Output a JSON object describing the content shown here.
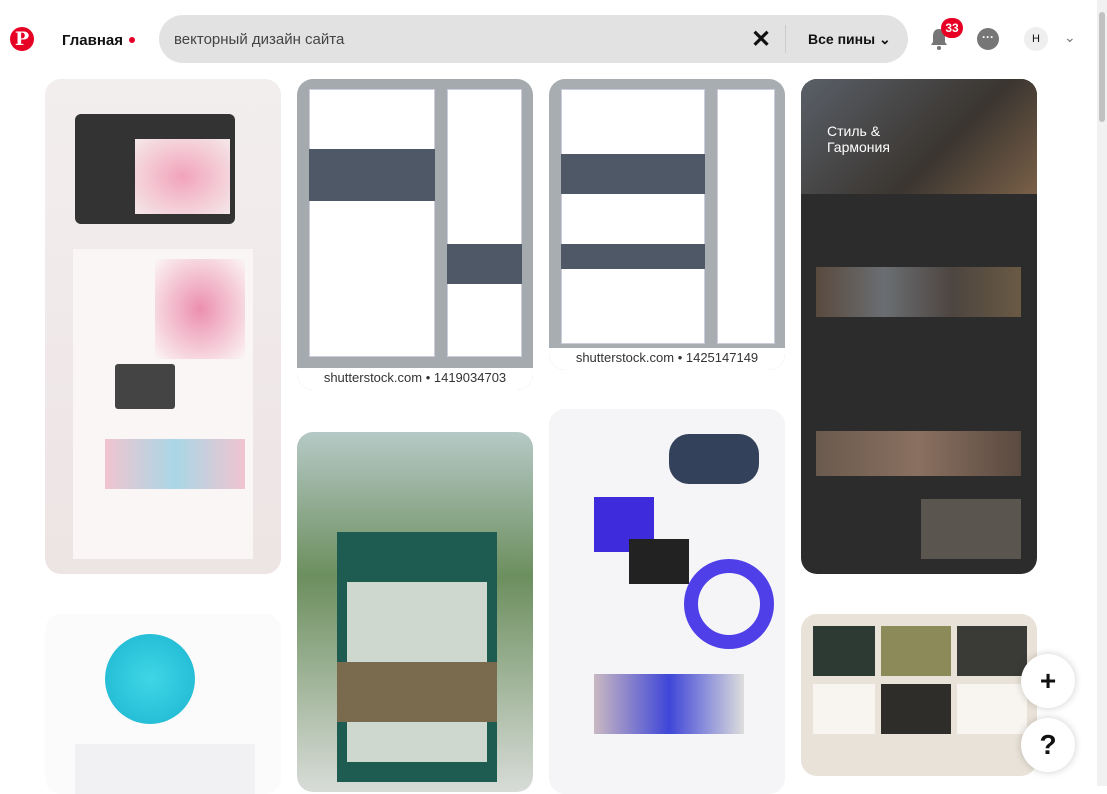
{
  "header": {
    "logo": "P",
    "home_label": "Главная",
    "search_value": "векторный дизайн сайта",
    "clear_icon": "x-icon",
    "filter_label": "Все пины",
    "notifications_count": "33",
    "avatar_initial": "Н"
  },
  "pins": [
    {
      "caption": ""
    },
    {
      "caption": "shutterstock.com • 1419034703"
    },
    {
      "caption": "shutterstock.com • 1425147149"
    },
    {
      "text": "Стиль & Гармония"
    }
  ],
  "fabs": {
    "add": "+",
    "help": "?"
  },
  "colors": {
    "brand": "#e60023",
    "search_bg": "#e2e2e2"
  }
}
